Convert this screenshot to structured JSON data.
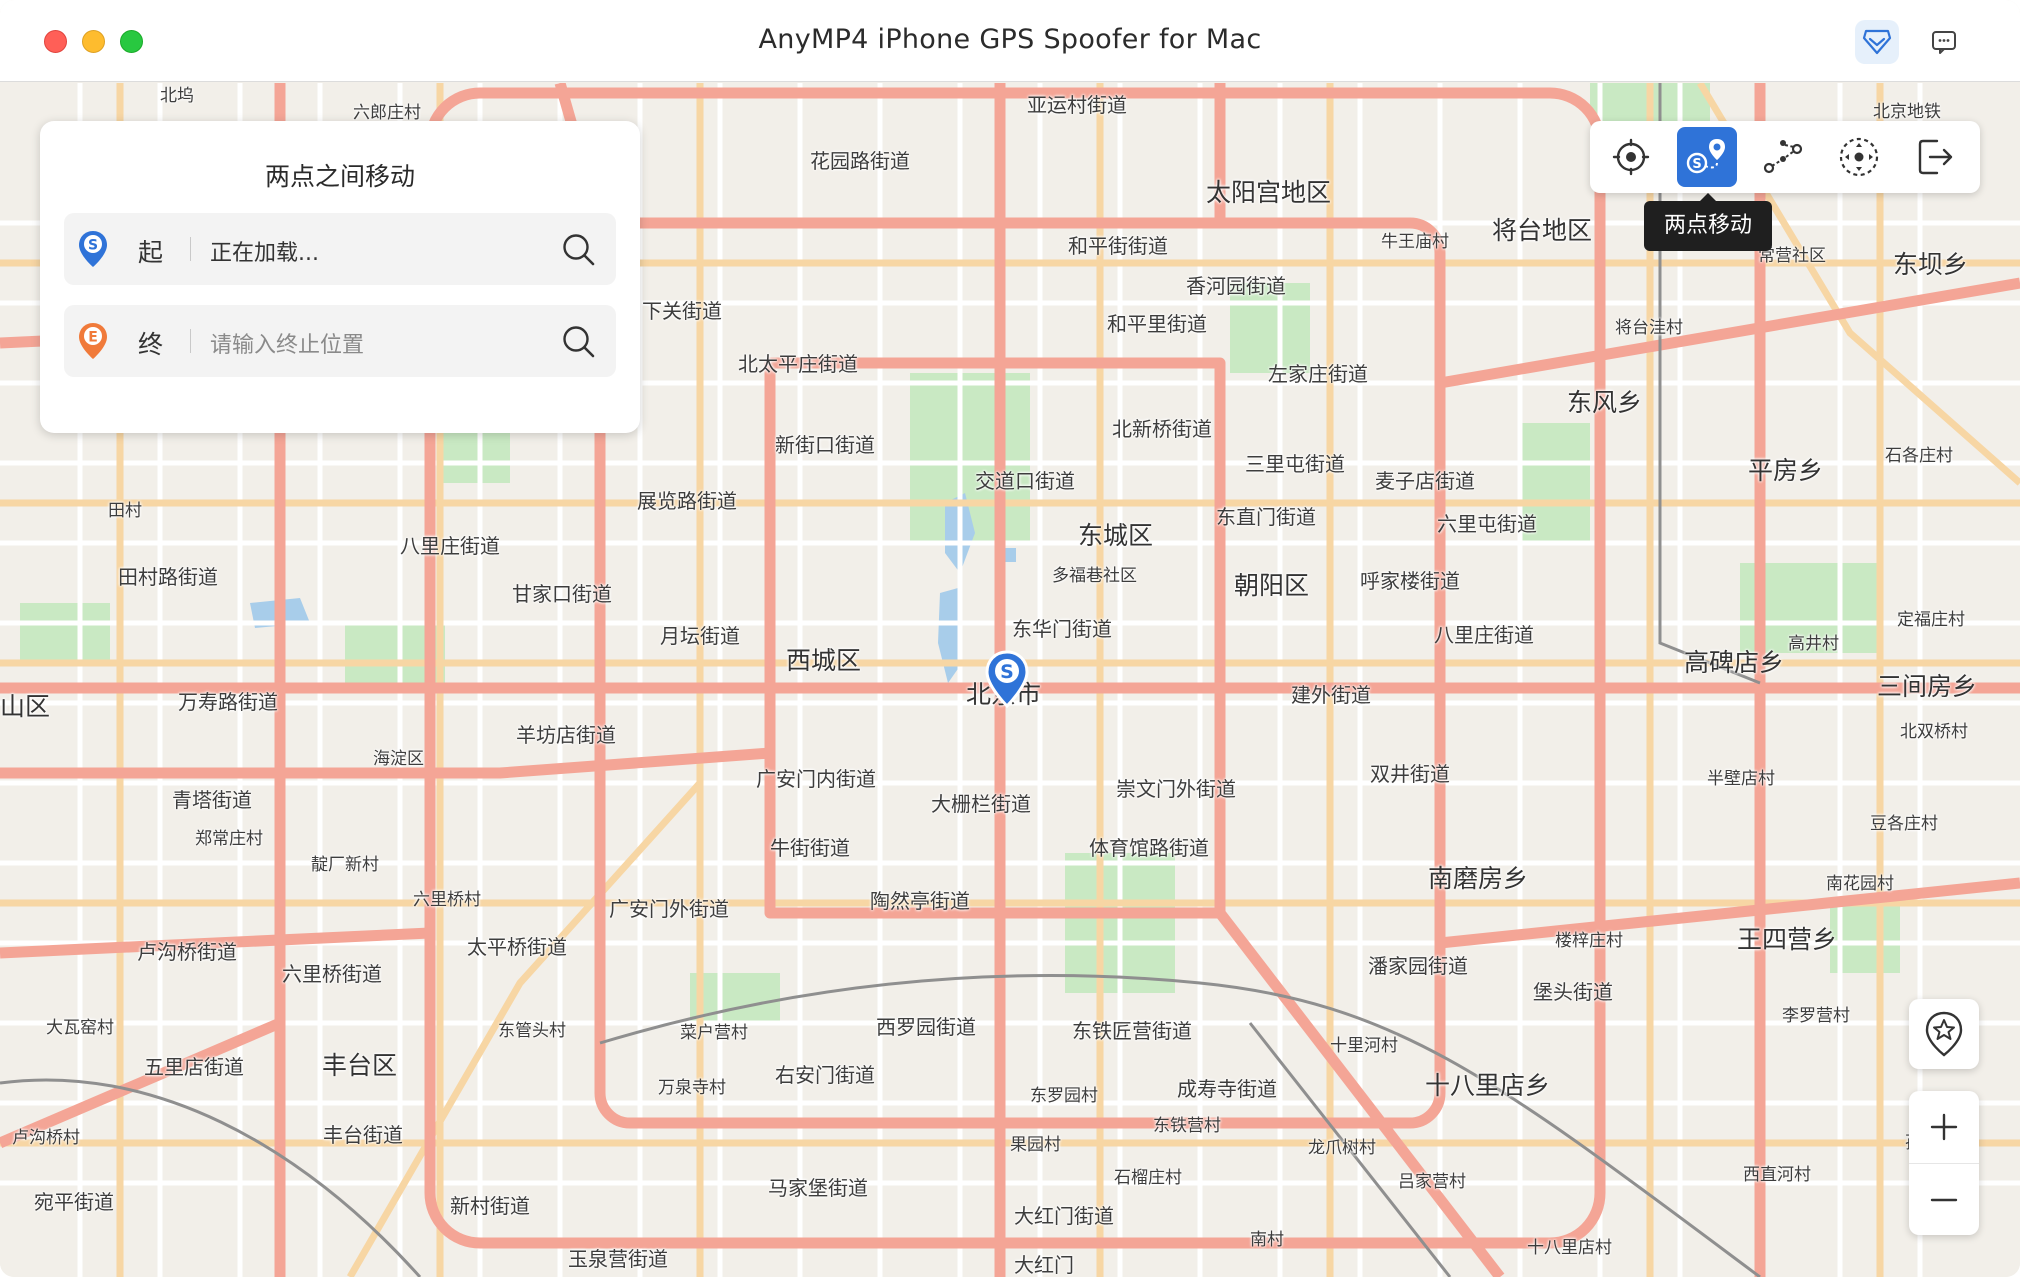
{
  "window": {
    "title": "AnyMP4 iPhone GPS Spoofer for Mac"
  },
  "panel": {
    "title": "两点之间移动",
    "start": {
      "label": "起",
      "value": "正在加载..."
    },
    "end": {
      "label": "终",
      "placeholder": "请输入终止位置"
    }
  },
  "toolbar": {
    "tools": [
      {
        "icon": "modify-location-icon"
      },
      {
        "icon": "two-point-route-icon",
        "active": true
      },
      {
        "icon": "multi-stop-route-icon"
      },
      {
        "icon": "joystick-icon"
      },
      {
        "icon": "exit-icon"
      }
    ],
    "tooltip": "两点移动"
  },
  "colors": {
    "accent": "#2f73d8",
    "start_pin": "#2f73d8",
    "end_pin": "#f07a3a",
    "major_road": "#f4a596",
    "secondary_road": "#f7d6a4",
    "park": "#c9e9c3",
    "water": "#a8cdea"
  },
  "map": {
    "districts": [
      "东城区",
      "西城区",
      "朝阳区",
      "丰台区",
      "北京市",
      "南磨房乡",
      "十八里店乡",
      "太阳宫地区",
      "将台地区",
      "东风乡",
      "平房乡",
      "高碑店乡",
      "三间房乡",
      "王四营乡",
      "山区"
    ],
    "labels": [
      "北坞",
      "六郎庄村",
      "亚运村街道",
      "北京地铁",
      "花园路街道",
      "和平街街道",
      "香河园街道",
      "牛王庙村",
      "常营社区",
      "东坝乡",
      "下关街道",
      "和平里街道",
      "将台洼村",
      "北太平庄街道",
      "左家庄街道",
      "新街口街道",
      "北新桥街道",
      "三里屯街道",
      "麦子店街道",
      "石各庄村",
      "交道口街道",
      "东直门街道",
      "六里屯街道",
      "田村",
      "展览路街道",
      "八里庄街道",
      "多福巷社区",
      "呼家楼街道",
      "田村路街道",
      "甘家口街道",
      "东华门街道",
      "八里庄街道",
      "定福庄村",
      "月坛街道",
      "高井村",
      "建外街道",
      "万寿路街道",
      "北双桥村",
      "羊坊店街道",
      "海淀区",
      "双井街道",
      "半壁店村",
      "广安门内街道",
      "崇文门外街道",
      "青塔街道",
      "大栅栏街道",
      "豆各庄村",
      "郑常庄村",
      "牛街街道",
      "体育馆路街道",
      "靛厂新村",
      "六里桥村",
      "陶然亭街道",
      "南花园村",
      "广安门外街道",
      "楼梓庄村",
      "卢沟桥街道",
      "太平桥街道",
      "潘家园街道",
      "六里桥街道",
      "堡头街道",
      "大瓦窑村",
      "西罗园街道",
      "东铁匠营街道",
      "李罗营村",
      "东管头村",
      "菜户营村",
      "十里河村",
      "五里店街道",
      "万泉寺村",
      "右安门街道",
      "成寿寺街道",
      "东罗园村",
      "东铁营村",
      "卢沟桥村",
      "丰台街道",
      "龙爪树村",
      "孙家",
      "果园村",
      "西直河村",
      "马家堡街道",
      "石榴庄村",
      "吕家营村",
      "宛平街道",
      "新村街道",
      "大红门街道",
      "玉泉营街道",
      "南村",
      "十八里店村",
      "大红门"
    ]
  }
}
